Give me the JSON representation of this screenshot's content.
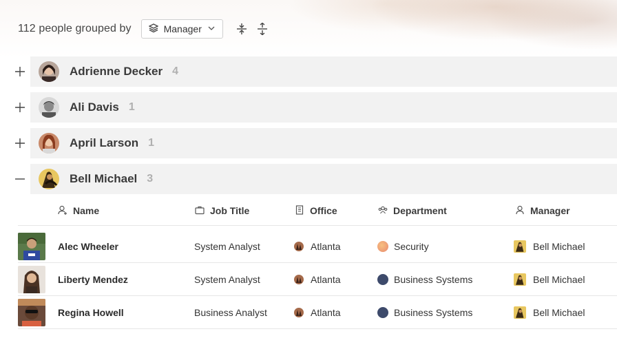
{
  "toolbar": {
    "summary": "112 people grouped by",
    "group_by_value": "Manager"
  },
  "groups": [
    {
      "name": "Adrienne Decker",
      "count": "4",
      "expanded": false
    },
    {
      "name": "Ali Davis",
      "count": "1",
      "expanded": false
    },
    {
      "name": "April Larson",
      "count": "1",
      "expanded": false
    },
    {
      "name": "Bell Michael",
      "count": "3",
      "expanded": true
    }
  ],
  "table": {
    "columns": [
      "Name",
      "Job Title",
      "Office",
      "Department",
      "Manager"
    ],
    "rows": [
      {
        "name": "Alec Wheeler",
        "job_title": "System Analyst",
        "office": "Atlanta",
        "department": "Security",
        "department_color": "#f0a070",
        "manager": "Bell Michael"
      },
      {
        "name": "Liberty Mendez",
        "job_title": "System Analyst",
        "office": "Atlanta",
        "department": "Business Systems",
        "department_color": "#3d4a6b",
        "manager": "Bell Michael"
      },
      {
        "name": "Regina Howell",
        "job_title": "Business Analyst",
        "office": "Atlanta",
        "department": "Business Systems",
        "department_color": "#3d4a6b",
        "manager": "Bell Michael"
      }
    ]
  }
}
